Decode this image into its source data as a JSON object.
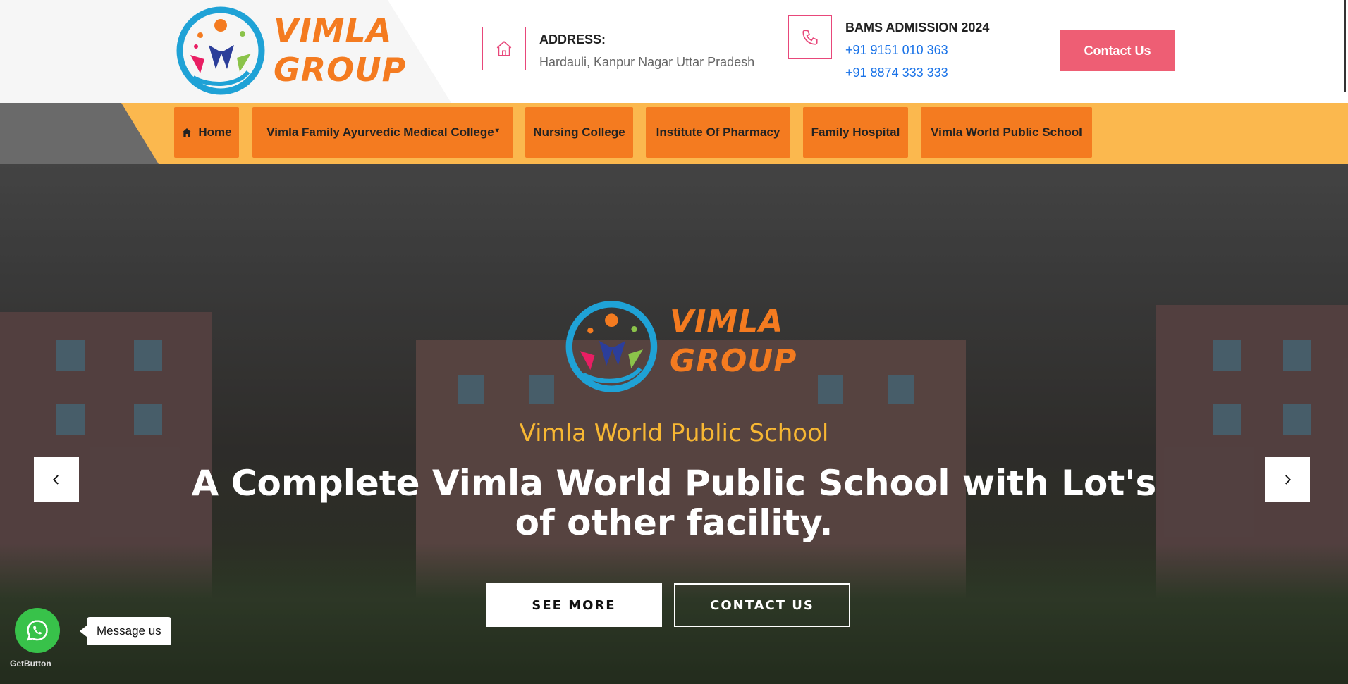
{
  "brand": {
    "line1": "VIMLA",
    "line2": "GROUP"
  },
  "header": {
    "address_title": "ADDRESS:",
    "address_text": "Hardauli, Kanpur Nagar Uttar Pradesh",
    "admission_title": "BAMS ADMISSION 2024",
    "phone1": "+91 9151 010 363",
    "phone2": "+91 8874 333 333",
    "contact_button": "Contact Us"
  },
  "nav": {
    "items": [
      {
        "label": "Home",
        "icon": "home-icon"
      },
      {
        "label": "Vimla Family Ayurvedic Medical College",
        "caret": "▾"
      },
      {
        "label": "Nursing College"
      },
      {
        "label": "Institute Of Pharmacy"
      },
      {
        "label": "Family Hospital"
      },
      {
        "label": "Vimla World Public School"
      }
    ]
  },
  "hero": {
    "subtitle": "Vimla World Public School",
    "title": "A Complete Vimla World Public School with Lot's of other facility.",
    "see_more": "SEE MORE",
    "contact_us": "CONTACT US"
  },
  "whatsapp": {
    "message": "Message us",
    "badge": "GetButton"
  },
  "colors": {
    "accent": "#f47b20",
    "navbar": "#fbb84e",
    "contact": "#ee5e74",
    "link": "#1a73e8",
    "hero_sub": "#f7b733"
  }
}
